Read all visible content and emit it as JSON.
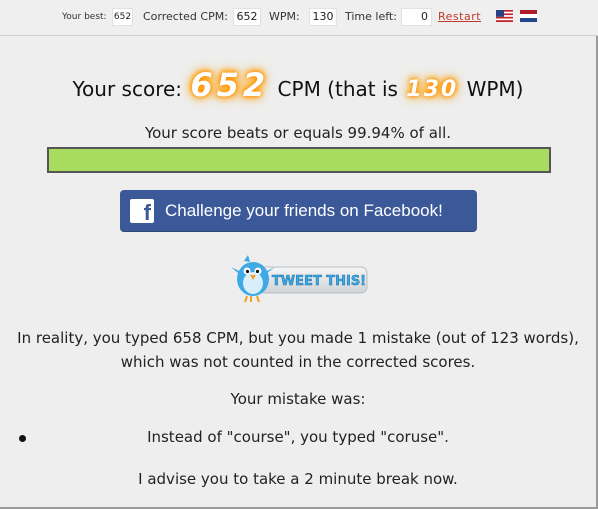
{
  "stats": {
    "best_label": "Your best:",
    "best_value": "652",
    "corrected_cpm_label": "Corrected CPM:",
    "corrected_cpm_value": "652",
    "wpm_label": "WPM:",
    "wpm_value": "130",
    "time_left_label": "Time left:",
    "time_left_value": "0",
    "restart_label": "Restart"
  },
  "score": {
    "prefix": "Your score:",
    "cpm": "652",
    "middle": "CPM (that is",
    "wpm": "130",
    "suffix": "WPM)"
  },
  "percentile": {
    "text": "Your score beats or equals 99.94% of all.",
    "fraction": 0.9994,
    "color": "#a8dc5e"
  },
  "facebook": {
    "logo": "f",
    "label": "Challenge your friends on Facebook!",
    "color": "#3b5998"
  },
  "tweet": {
    "label": "TWEET THIS!"
  },
  "summary": {
    "line1": "In reality, you typed 658 CPM, but you made 1 mistake (out of 123 words),",
    "line2": "which was not counted in the corrected scores."
  },
  "mistakes": {
    "title": "Your mistake was:",
    "items": [
      "Instead of \"course\", you typed \"coruse\"."
    ]
  },
  "advice": "I advise you to take a 2 minute break now.",
  "icons": {
    "flag_us": "us-flag-icon",
    "flag_nl": "nl-flag-icon",
    "bird": "twitter-bird-icon"
  }
}
